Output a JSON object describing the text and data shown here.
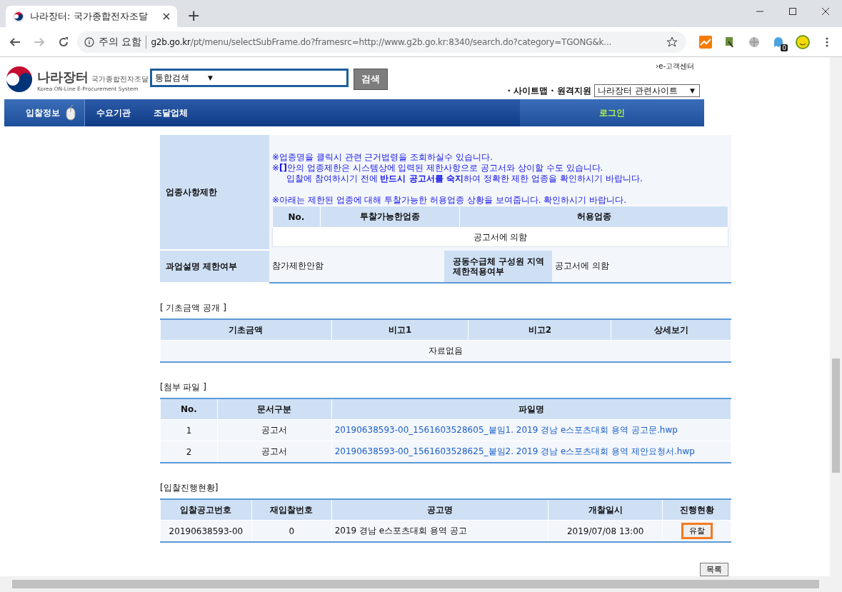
{
  "browser": {
    "tab_title": "나라장터: 국가종합전자조달",
    "new_tab": "+",
    "security": "주의 요함",
    "url_host": "g2b.go.kr",
    "url_rest": "/pt/menu/selectSubFrame.do?framesrc=http://www.g2b.go.kr:8340/search.do?category=TGONG&k...",
    "badge": "0"
  },
  "header": {
    "logo_title": "나라장터",
    "logo_sub": "국가종합전자조달",
    "logo_en": "Korea ON-Line E-Procurement System",
    "search_select": "통합검색",
    "select_arrow": "▼",
    "search_button": "검색",
    "help_link": "›e-고객센터",
    "links": [
      "· 사이트맵",
      "· 원격지원"
    ],
    "related_select": "나라장터 관련사이트",
    "related_arrow": "▼"
  },
  "nav": {
    "items": [
      {
        "label": "입찰정보",
        "selected": true
      },
      {
        "label": "수요기관",
        "selected": false
      },
      {
        "label": "조달업체",
        "selected": false
      }
    ],
    "login": "로그인"
  },
  "restriction": {
    "label": "업종사항제한",
    "note_groups": [
      [
        {
          "text": "※업종명을 클릭시 관련 근거법령을 조회하실수 있습니다.",
          "indent": false
        },
        {
          "text": "※**[]**안의 업종제한은 시스템상에 입력된 제한사항으로 공고서와 상이할 수도 있습니다.",
          "indent": false
        },
        {
          "text": "입찰에 참여하시기 전에 **반드시 공고서를 숙지**하여 정확한 제한 업종을 확인하시기 바랍니다.",
          "indent": true
        }
      ],
      [
        {
          "text": "※아래는 제한된 업종에 대해 투찰가능한 허용업종 상황을 보여줍니다. 확인하시기 바랍니다.",
          "indent": false
        }
      ]
    ],
    "columns": [
      "No.",
      "투찰가능한업종",
      "허용업종"
    ],
    "message": "공고서에 의함",
    "row2": {
      "label": "과업설명 제한여부",
      "value": "참가제한안함",
      "label2": "공동수급체 구성원 지역 제한적용여부",
      "value2": "공고서에 의함"
    }
  },
  "basic_price": {
    "title": "[ 기초금액 공개 ]",
    "columns": [
      "기초금액",
      "비고1",
      "비고2",
      "상세보기"
    ],
    "empty": "자료없음"
  },
  "attachments": {
    "title": "[첨부 파일 ]",
    "columns": [
      "No.",
      "문서구분",
      "파일명"
    ],
    "rows": [
      {
        "no": "1",
        "type": "공고서",
        "file": "20190638593-00_1561603528605_붙임1. 2019 경남 e스포츠대회 용역 공고문.hwp"
      },
      {
        "no": "2",
        "type": "공고서",
        "file": "20190638593-00_1561603528625_붙임2. 2019 경남 e스포츠대회 용역 제안요청서.hwp"
      }
    ]
  },
  "progress": {
    "title": "[입찰진행현황]",
    "columns": [
      "입찰공고번호",
      "재입찰번호",
      "공고명",
      "개찰일시",
      "진행현황"
    ],
    "rows": [
      {
        "notice_no": "20190638593-00",
        "rebid_no": "0",
        "name": "2019 경남 e스포츠대회 용역 공고",
        "open_date": "2019/07/08 13:00",
        "status": "유찰"
      }
    ]
  },
  "list_button": "목록"
}
